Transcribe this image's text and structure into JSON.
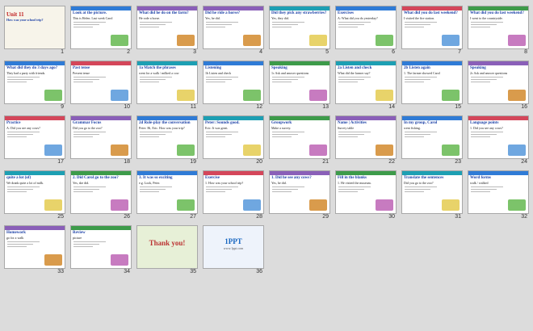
{
  "slides": [
    {
      "n": "1",
      "title": "Unit 11",
      "sub": "How was your school trip?",
      "theme": "special-1"
    },
    {
      "n": "2",
      "title": "Look at the picture.",
      "sub": "This is Helen. Last week Carol",
      "theme": "th1"
    },
    {
      "n": "3",
      "title": "What did he do on the farm?",
      "sub": "He rode a horse.",
      "theme": "th2"
    },
    {
      "n": "4",
      "title": "Did he ride a horse?",
      "sub": "Yes, he did.",
      "theme": "th2"
    },
    {
      "n": "5",
      "title": "Did they pick any strawberries?",
      "sub": "Yes, they did.",
      "theme": "th3"
    },
    {
      "n": "6",
      "title": "Exercises",
      "sub": "A: What did you do yesterday?",
      "theme": "th1"
    },
    {
      "n": "7",
      "title": "What did you do last weekend?",
      "sub": "I visited the fire station.",
      "theme": "th4"
    },
    {
      "n": "8",
      "title": "What did you do last weekend?",
      "sub": "I went to the countryside.",
      "theme": "th5"
    },
    {
      "n": "9",
      "title": "What did they do 3 days ago?",
      "sub": "They had a party with friends.",
      "theme": "th1"
    },
    {
      "n": "10",
      "title": "Past tense",
      "sub": "Present tense",
      "theme": "th4"
    },
    {
      "n": "11",
      "title": "1a Match the phrases",
      "sub": "went for a walk / milked a cow",
      "theme": "th3"
    },
    {
      "n": "12",
      "title": "Listening",
      "sub": "1b Listen and check",
      "theme": "th1"
    },
    {
      "n": "13",
      "title": "Speaking",
      "sub": "1c Ask and answer questions",
      "theme": "th5"
    },
    {
      "n": "14",
      "title": "2a Listen and check",
      "sub": "What did the farmer say?",
      "theme": "th3"
    },
    {
      "n": "15",
      "title": "2b Listen again",
      "sub": "1. The farmer showed Carol",
      "theme": "th1"
    },
    {
      "n": "16",
      "title": "Speaking",
      "sub": "2c Ask and answer questions",
      "theme": "th2"
    },
    {
      "n": "17",
      "title": "Practice",
      "sub": "A: Did you see any cows?",
      "theme": "th4"
    },
    {
      "n": "18",
      "title": "Grammar Focus",
      "sub": "Did you go to the zoo?",
      "theme": "th2"
    },
    {
      "n": "19",
      "title": "2d Role-play the conversation",
      "sub": "Peter: Hi, Eric. How was your trip?",
      "theme": "th1"
    },
    {
      "n": "20",
      "title": "Peter: Sounds good.",
      "sub": "Eric: It was great.",
      "theme": "th3"
    },
    {
      "n": "21",
      "title": "Groupwork",
      "sub": "Make a survey.",
      "theme": "th5"
    },
    {
      "n": "22",
      "title": "Name | Activities",
      "sub": "Survey table",
      "theme": "th2"
    },
    {
      "n": "23",
      "title": "In my group, Carol",
      "sub": "went fishing.",
      "theme": "th1"
    },
    {
      "n": "24",
      "title": "Language points",
      "sub": "1. Did you see any cows?",
      "theme": "th4"
    },
    {
      "n": "25",
      "title": "quite a lot (of)",
      "sub": "We drank quite a lot of milk.",
      "theme": "th3"
    },
    {
      "n": "26",
      "title": "2. Did Carol go to the zoo?",
      "sub": "Yes, she did.",
      "theme": "th5"
    },
    {
      "n": "27",
      "title": "3. It was so exciting",
      "sub": "e.g. Look, Peter.",
      "theme": "th1"
    },
    {
      "n": "28",
      "title": "Exercise",
      "sub": "1. How was your school trip?",
      "theme": "th4"
    },
    {
      "n": "29",
      "title": "1. Did he see any cows?",
      "sub": "Yes, he did.",
      "theme": "th2"
    },
    {
      "n": "30",
      "title": "Fill in the blanks",
      "sub": "1. He visited the museum.",
      "theme": "th5"
    },
    {
      "n": "31",
      "title": "Translate the sentences",
      "sub": "Did you go to the zoo?",
      "theme": "th3"
    },
    {
      "n": "32",
      "title": "Word forms",
      "sub": "walk / walked",
      "theme": "th1"
    },
    {
      "n": "33",
      "title": "Homework",
      "sub": "go for a walk",
      "theme": "th2"
    },
    {
      "n": "34",
      "title": "Review",
      "sub": "picture",
      "theme": "th5"
    },
    {
      "n": "35",
      "title": "Thank you!",
      "sub": "",
      "theme": "special-35"
    },
    {
      "n": "36",
      "title": "1PPT",
      "sub": "www.1ppt.com",
      "theme": "special-36"
    }
  ]
}
